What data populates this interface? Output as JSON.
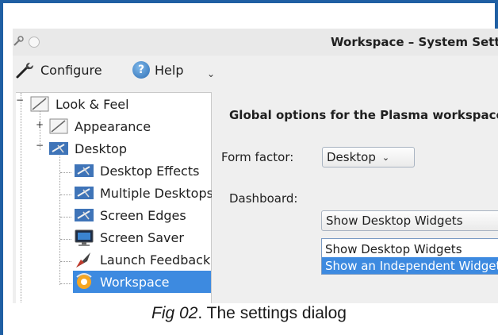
{
  "window": {
    "title": "Workspace – System Settings"
  },
  "toolbar": {
    "configure_label": "Configure",
    "help_label": "Help",
    "more_label": "⌄"
  },
  "tree": {
    "items": [
      {
        "label": "Look & Feel",
        "icon": "look-and-feel-icon"
      },
      {
        "label": "Appearance",
        "icon": "appearance-icon"
      },
      {
        "label": "Desktop",
        "icon": "desktop-icon"
      },
      {
        "label": "Desktop Effects",
        "icon": "desktop-effects-icon"
      },
      {
        "label": "Multiple Desktops",
        "icon": "multiple-desktops-icon"
      },
      {
        "label": "Screen Edges",
        "icon": "screen-edges-icon"
      },
      {
        "label": "Screen Saver",
        "icon": "screen-saver-icon"
      },
      {
        "label": "Launch Feedback",
        "icon": "launch-feedback-icon"
      },
      {
        "label": "Workspace",
        "icon": "workspace-icon",
        "selected": true
      }
    ]
  },
  "main": {
    "heading": "Global options for the Plasma workspace",
    "form_factor": {
      "label": "Form factor:",
      "value": "Desktop"
    },
    "dashboard": {
      "label": "Dashboard:",
      "value": "Show Desktop Widgets",
      "options": [
        "Show Desktop Widgets",
        "Show an Independent Widget Set"
      ],
      "highlighted_index": 1
    }
  },
  "caption": {
    "fig": "Fig 02",
    "text": ". The settings dialog"
  },
  "colors": {
    "frame": "#1f5fa3",
    "selection": "#3d8ae0"
  }
}
